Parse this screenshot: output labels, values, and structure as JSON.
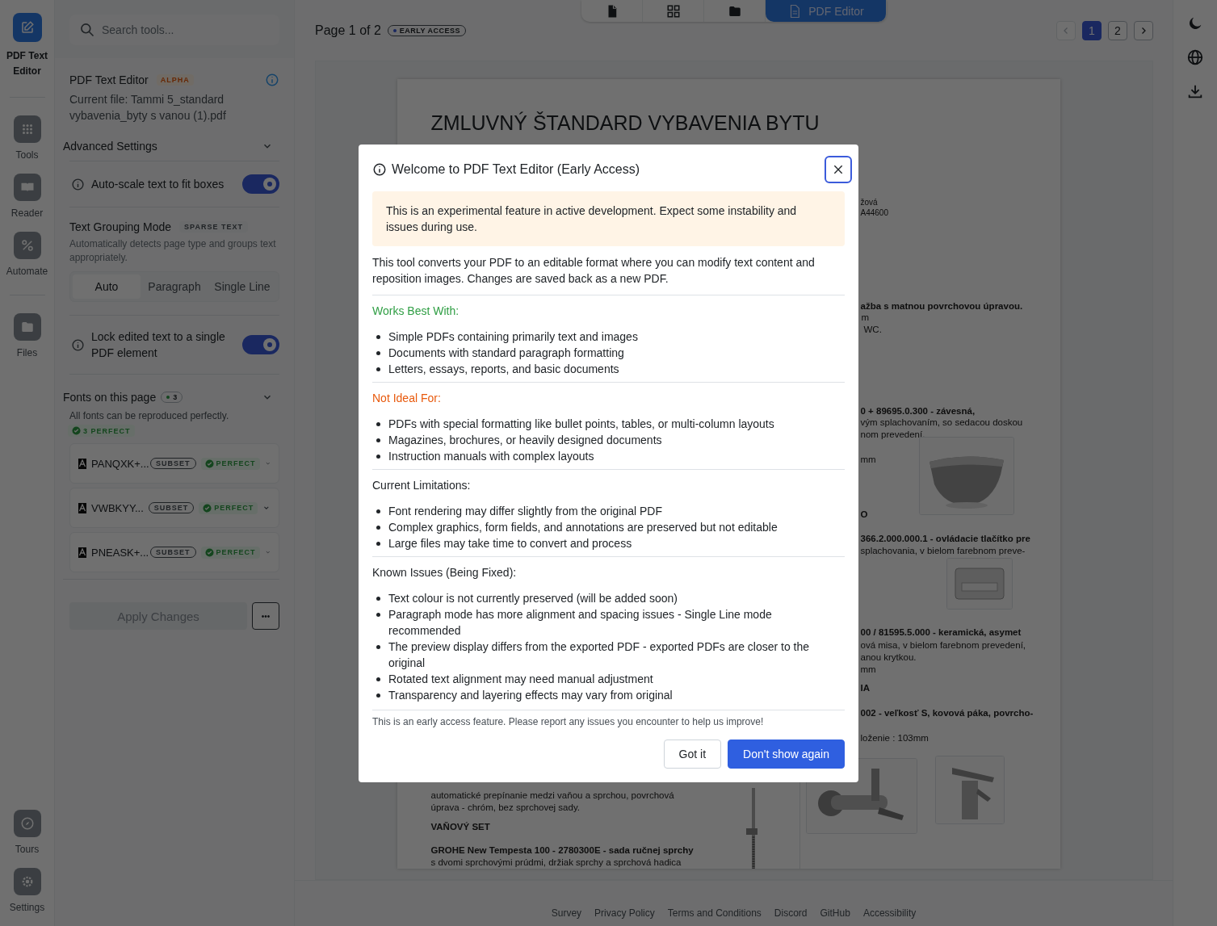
{
  "rail": {
    "items": [
      {
        "label": "PDF Text Editor",
        "selected": true
      },
      {
        "label": "Tools",
        "selected": false
      },
      {
        "label": "Reader",
        "selected": false
      },
      {
        "label": "Automate",
        "selected": false
      },
      {
        "label": "Files",
        "selected": false
      }
    ],
    "bottom": [
      {
        "label": "Tours",
        "selected": false
      },
      {
        "label": "Settings",
        "selected": false
      }
    ]
  },
  "panel": {
    "search": {
      "placeholder": "Search tools..."
    },
    "tool_title": "PDF Text Editor",
    "tool_badge": "ALPHA",
    "current_file": "Current file: Tammi 5_standard vybavenia_byty s vanou (1).pdf",
    "advanced_title": "Advanced Settings",
    "toggles": [
      {
        "label": "Auto-scale text to fit boxes",
        "on": true
      }
    ],
    "grouping": {
      "title": "Text Grouping Mode",
      "badge": "SPARSE TEXT",
      "description": "Automatically detects page type and groups text appropriately.",
      "options": [
        {
          "label": "Auto",
          "selected": true
        },
        {
          "label": "Paragraph",
          "selected": false
        },
        {
          "label": "Single Line",
          "selected": false
        }
      ]
    },
    "lock_toggle": {
      "label": "Lock edited text to a single PDF element",
      "on": true
    },
    "fonts_title": "Fonts on this page",
    "fonts_count": "3",
    "fonts_note": "All fonts can be reproduced perfectly.",
    "fonts_summary": "3 PERFECT",
    "fonts": [
      {
        "name": "PANQXK+...",
        "tag": "SUBSET",
        "status": "PERFECT"
      },
      {
        "name": "VWBKYY...",
        "tag": "SUBSET",
        "status": "PERFECT"
      },
      {
        "name": "PNEASK+...",
        "tag": "SUBSET",
        "status": "PERFECT"
      }
    ],
    "apply_button": "Apply Changes",
    "more_button": "•••"
  },
  "topbar": {
    "page_label": "Page 1 of 2",
    "badge": "EARLY ACCESS",
    "views": [
      {
        "selected": false
      },
      {
        "selected": false
      },
      {
        "selected": false
      },
      {
        "label": "PDF Editor",
        "selected": true
      }
    ],
    "pages": [
      {
        "label": "1",
        "selected": true
      },
      {
        "label": "2",
        "selected": false
      }
    ]
  },
  "document": {
    "title": "ZMLUVNÝ ŠTANDARD VYBAVENIA BYTU",
    "fragments": [
      {
        "text": "žová",
        "bold": false
      },
      {
        "text": "A44600",
        "bold": false
      },
      {
        "text": "ažba s matnou povrchovou úpravou.",
        "bold": true
      },
      {
        "text": "m",
        "bold": false
      },
      {
        "text": "WC.",
        "bold": false
      },
      {
        "text": "0 + 89695.0.300 - závesná,",
        "bold": true
      },
      {
        "text": "vým splachovaním, so sedacou doskou",
        "bold": false
      },
      {
        "text": "nom prevedení.",
        "bold": false
      },
      {
        "text": "mm",
        "bold": false
      },
      {
        "text": "O",
        "bold": true
      },
      {
        "text": "366.2.000.000.1 - ovládacie tlačítko pre",
        "bold": true
      },
      {
        "text": "splachovania, v bielom farebnom preve-",
        "bold": false
      },
      {
        "text": "00 / 81595.5.000 - keramická, asymet",
        "bold": true
      },
      {
        "text": "ová misa, v bielom farebnom prevedení,",
        "bold": false
      },
      {
        "text": "anou krytkou.",
        "bold": false
      },
      {
        "text": "mm",
        "bold": false
      },
      {
        "text": "IA",
        "bold": true
      },
      {
        "text": "002 - veľkosť S, kovová páka, povrcho-",
        "bold": true
      },
      {
        "text": "loženie : 103mm",
        "bold": false
      },
      {
        "text": "automatické prepínanie medzi vaňou a sprchou, povrchová",
        "bold": false
      },
      {
        "text": "úprava - chróm, bez sprchovej sady.",
        "bold": false
      },
      {
        "text": "VAŇOVÝ SET",
        "bold": true
      },
      {
        "text": "GROHE New Tempesta 100 - 2780300E - sada ručnej sprchy",
        "bold": true
      },
      {
        "text": "s dvomi sprchovými prúdmi, držiak sprchy a sprchová hadica",
        "bold": false
      }
    ]
  },
  "footer": {
    "links": [
      "Survey",
      "Privacy Policy",
      "Terms and Conditions",
      "Discord",
      "GitHub",
      "Accessibility"
    ]
  },
  "dialog": {
    "title": "Welcome to PDF Text Editor (Early Access)",
    "warning": "This is an experimental feature in active development. Expect some instability and issues during use.",
    "intro": "This tool converts your PDF to an editable format where you can modify text content and reposition images. Changes are saved back as a new PDF.",
    "sections": [
      {
        "kind": "good",
        "heading": "Works Best With:",
        "items": [
          "Simple PDFs containing primarily text and images",
          "Documents with standard paragraph formatting",
          "Letters, essays, reports, and basic documents"
        ]
      },
      {
        "kind": "bad",
        "heading": "Not Ideal For:",
        "items": [
          "PDFs with special formatting like bullet points, tables, or multi-column layouts",
          "Magazines, brochures, or heavily designed documents",
          "Instruction manuals with complex layouts"
        ]
      },
      {
        "kind": "neutral",
        "heading": "Current Limitations:",
        "items": [
          "Font rendering may differ slightly from the original PDF",
          "Complex graphics, form fields, and annotations are preserved but not editable",
          "Large files may take time to convert and process"
        ]
      },
      {
        "kind": "neutral",
        "heading": "Known Issues (Being Fixed):",
        "items": [
          "Text colour is not currently preserved (will be added soon)",
          "Paragraph mode has more alignment and spacing issues - Single Line mode recommended",
          "The preview display differs from the exported PDF - exported PDFs are closer to the original",
          "Rotated text alignment may need manual adjustment",
          "Transparency and layering effects may vary from original"
        ]
      }
    ],
    "note": "This is an early access feature. Please report any issues you encounter to help us improve!",
    "buttons": [
      {
        "label": "Got it",
        "kind": "secondary"
      },
      {
        "label": "Don't show again",
        "kind": "primary"
      }
    ]
  }
}
